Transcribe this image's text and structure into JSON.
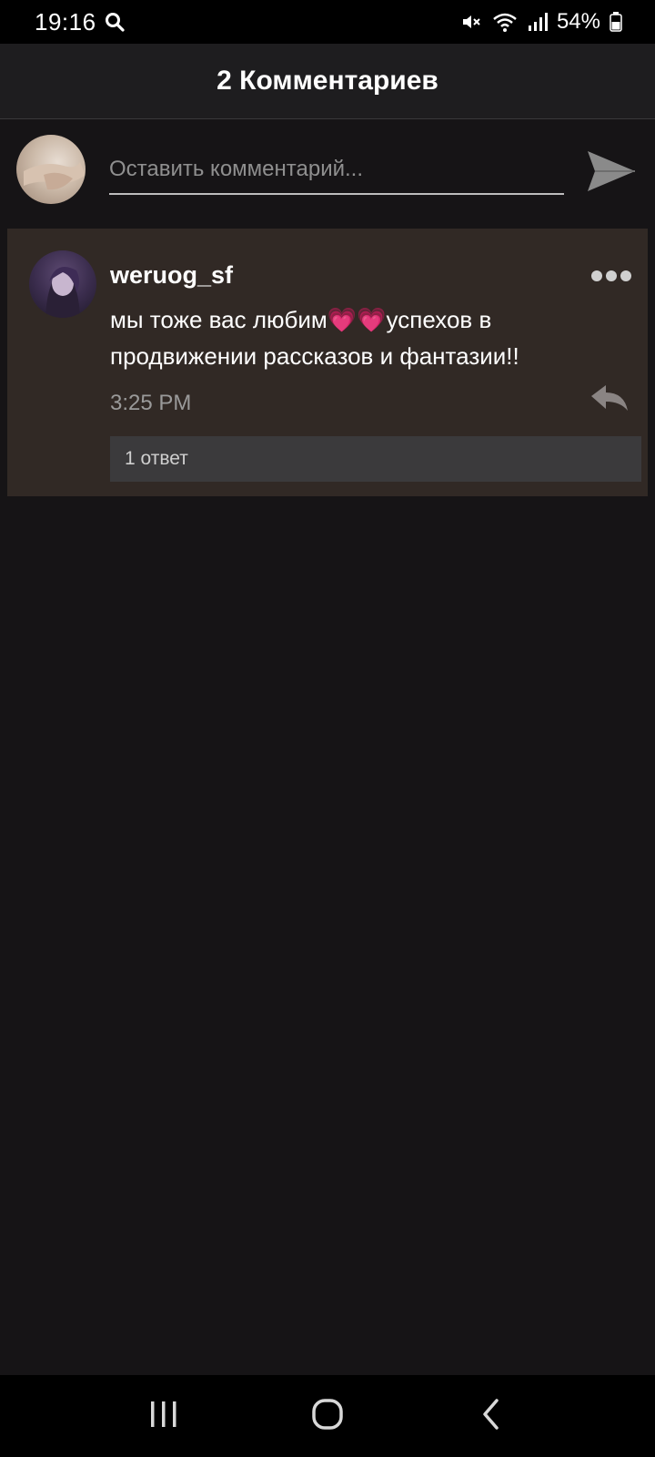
{
  "status_bar": {
    "time": "19:16",
    "battery": "54%",
    "icons": [
      "search-icon",
      "mute-icon",
      "wifi-icon",
      "signal-icon",
      "battery-icon"
    ]
  },
  "header": {
    "title": "2 Комментариев"
  },
  "compose": {
    "placeholder": "Оставить комментарий..."
  },
  "comment": {
    "username": "weruog_sf",
    "text": "мы тоже вас любим💗💗успехов в продвижении рассказов и фантазии!!",
    "time": "3:25 PM",
    "replies_label": "1 ответ"
  },
  "colors": {
    "background": "#161416",
    "header_bg": "#1e1d1f",
    "comment_bg": "#312925",
    "replies_bg": "#3b3a3c",
    "muted_text": "#9a9a9a"
  },
  "nav_icons": [
    "recent-apps-icon",
    "home-icon",
    "back-icon"
  ]
}
